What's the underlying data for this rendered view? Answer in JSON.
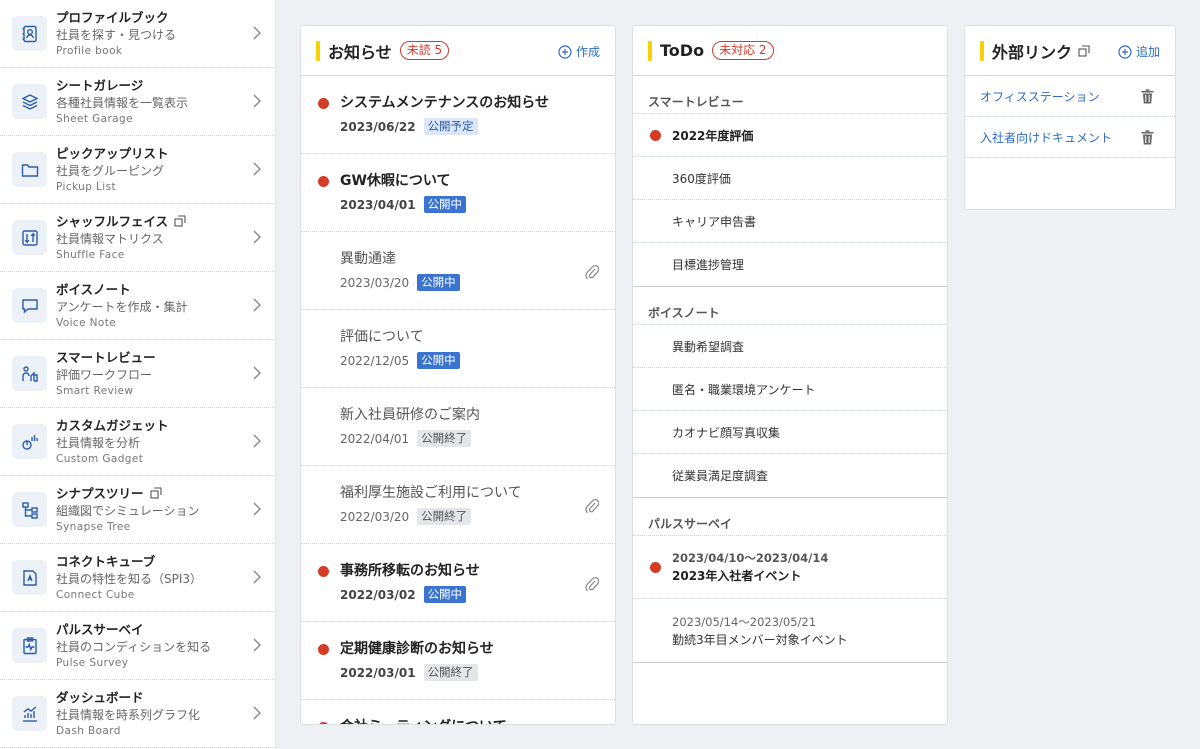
{
  "sidebar": {
    "items": [
      {
        "title": "プロファイルブック",
        "sub": "社員を探す・見つける",
        "en": "Profile book"
      },
      {
        "title": "シートガレージ",
        "sub": "各種社員情報を一覧表示",
        "en": "Sheet Garage"
      },
      {
        "title": "ピックアップリスト",
        "sub": "社員をグルーピング",
        "en": "Pickup List"
      },
      {
        "title": "シャッフルフェイス",
        "sub": "社員情報マトリクス",
        "en": "Shuffle Face"
      },
      {
        "title": "ボイスノート",
        "sub": "アンケートを作成・集計",
        "en": "Voice Note"
      },
      {
        "title": "スマートレビュー",
        "sub": "評価ワークフロー",
        "en": "Smart Review"
      },
      {
        "title": "カスタムガジェット",
        "sub": "社員情報を分析",
        "en": "Custom Gadget"
      },
      {
        "title": "シナプスツリー",
        "sub": "組織図でシミュレーション",
        "en": "Synapse Tree"
      },
      {
        "title": "コネクトキューブ",
        "sub": "社員の特性を知る（SPI3）",
        "en": "Connect Cube"
      },
      {
        "title": "パルスサーベイ",
        "sub": "社員のコンディションを知る",
        "en": "Pulse Survey"
      },
      {
        "title": "ダッシュボード",
        "sub": "社員情報を時系列グラフ化",
        "en": "Dash Board"
      }
    ]
  },
  "news": {
    "title": "お知らせ",
    "badge": "未読 5",
    "action": "作成",
    "items": [
      {
        "title": "システムメンテナンスのお知らせ",
        "date": "2023/06/22",
        "status": "公開予定"
      },
      {
        "title": "GW休暇について",
        "date": "2023/04/01",
        "status": "公開中"
      },
      {
        "title": "異動通達",
        "date": "2023/03/20",
        "status": "公開中"
      },
      {
        "title": "評価について",
        "date": "2022/12/05",
        "status": "公開中"
      },
      {
        "title": "新入社員研修のご案内",
        "date": "2022/04/01",
        "status": "公開終了"
      },
      {
        "title": "福利厚生施設ご利用について",
        "date": "2022/03/20",
        "status": "公開終了"
      },
      {
        "title": "事務所移転のお知らせ",
        "date": "2022/03/02",
        "status": "公開中"
      },
      {
        "title": "定期健康診断のお知らせ",
        "date": "2022/03/01",
        "status": "公開終了"
      },
      {
        "title": "会社ミーティングについて",
        "date": "",
        "status": ""
      }
    ]
  },
  "todo": {
    "title": "ToDo",
    "badge": "未対応 2",
    "sections": [
      {
        "title": "スマートレビュー",
        "items": [
          "2022年度評価",
          "360度評価",
          "キャリア申告書",
          "目標進捗管理"
        ]
      },
      {
        "title": "ボイスノート",
        "items": [
          "異動希望調査",
          "匿名・職業環境アンケート",
          "カオナビ顔写真収集",
          "従業員満足度調査"
        ]
      },
      {
        "title": "パルスサーベイ",
        "events": [
          {
            "range": "2023/04/10〜2023/04/14",
            "name": "2023年入社者イベント"
          },
          {
            "range": "2023/05/14〜2023/05/21",
            "name": "勤続3年目メンバー対象イベント"
          }
        ]
      }
    ]
  },
  "links": {
    "title": "外部リンク",
    "action": "追加",
    "items": [
      "オフィスステーション",
      "入社者向けドキュメント"
    ]
  }
}
